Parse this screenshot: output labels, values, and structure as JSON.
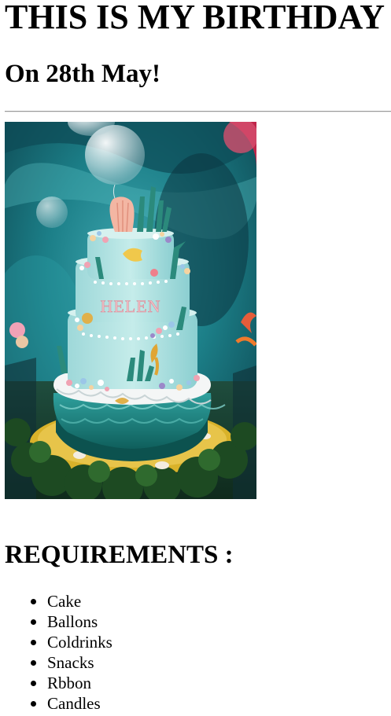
{
  "page": {
    "title": "THIS IS MY BIRTHDAY",
    "subtitle": "On 28th May!"
  },
  "photo": {
    "subject": "birthday-cake-image",
    "cake_lettering": "HELEN"
  },
  "requirements": {
    "heading": "REQUIREMENTS :",
    "items": [
      "Cake",
      "Ballons",
      "Coldrinks",
      "Snacks",
      "Rbbon",
      "Candles"
    ]
  },
  "colors": {
    "text": "#000000",
    "rule": "#9b9b9b",
    "background": "#ffffff"
  }
}
